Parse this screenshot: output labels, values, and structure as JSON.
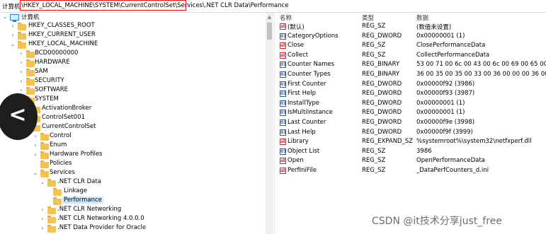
{
  "address": {
    "label": "计算机",
    "path": "\\HKEY_LOCAL_MACHINE\\SYSTEM\\CurrentControlSet\\Services\\.NET CLR Data\\Performance"
  },
  "tree": {
    "root": "计算机",
    "items": [
      {
        "label": "HKEY_CLASSES_ROOT"
      },
      {
        "label": "HKEY_CURRENT_USER"
      },
      {
        "label": "HKEY_LOCAL_MACHINE"
      },
      {
        "label": "BCD00000000"
      },
      {
        "label": "HARDWARE"
      },
      {
        "label": "SAM"
      },
      {
        "label": "SECURITY"
      },
      {
        "label": "SOFTWARE"
      },
      {
        "label": "SYSTEM"
      },
      {
        "label": "ActivationBroker"
      },
      {
        "label": "ControlSet001"
      },
      {
        "label": "CurrentControlSet"
      },
      {
        "label": "Control"
      },
      {
        "label": "Enum"
      },
      {
        "label": "Hardware Profiles"
      },
      {
        "label": "Policies"
      },
      {
        "label": "Services"
      },
      {
        "label": ".NET CLR Data"
      },
      {
        "label": "Linkage"
      },
      {
        "label": "Performance"
      },
      {
        "label": ".NET CLR Networking"
      },
      {
        "label": ".NET CLR Networking 4.0.0.0"
      },
      {
        "label": ".NET Data Provider for Oracle"
      }
    ]
  },
  "list": {
    "headers": {
      "name": "名称",
      "type": "类型",
      "data": "数据"
    },
    "rows": [
      {
        "icon": "ab",
        "name": "(默认)",
        "type": "REG_SZ",
        "data": "(数值未设置)"
      },
      {
        "icon": "bin",
        "name": "CategoryOptions",
        "type": "REG_DWORD",
        "data": "0x00000001 (1)"
      },
      {
        "icon": "ab",
        "name": "Close",
        "type": "REG_SZ",
        "data": "ClosePerformanceData"
      },
      {
        "icon": "ab",
        "name": "Collect",
        "type": "REG_SZ",
        "data": "CollectPerformanceData"
      },
      {
        "icon": "bin",
        "name": "Counter Names",
        "type": "REG_BINARY",
        "data": "53 00 71 00 6c 00 43 00 6c 00 69 00 65 00 6e..."
      },
      {
        "icon": "bin",
        "name": "Counter Types",
        "type": "REG_BINARY",
        "data": "36 00 35 00 35 00 33 00 36 00 00 00 36 00 35..."
      },
      {
        "icon": "bin",
        "name": "First Counter",
        "type": "REG_DWORD",
        "data": "0x00000f92 (3986)"
      },
      {
        "icon": "bin",
        "name": "First Help",
        "type": "REG_DWORD",
        "data": "0x00000f93 (3987)"
      },
      {
        "icon": "bin",
        "name": "InstallType",
        "type": "REG_DWORD",
        "data": "0x00000001 (1)"
      },
      {
        "icon": "bin",
        "name": "IsMultiInstance",
        "type": "REG_DWORD",
        "data": "0x00000001 (1)"
      },
      {
        "icon": "bin",
        "name": "Last Counter",
        "type": "REG_DWORD",
        "data": "0x00000f9e (3998)"
      },
      {
        "icon": "bin",
        "name": "Last Help",
        "type": "REG_DWORD",
        "data": "0x00000f9f (3999)"
      },
      {
        "icon": "ab",
        "name": "Library",
        "type": "REG_EXPAND_SZ",
        "data": "%systemroot%\\system32\\netfxperf.dll"
      },
      {
        "icon": "bin",
        "name": "Object List",
        "type": "REG_SZ",
        "data": "3986"
      },
      {
        "icon": "ab",
        "name": "Open",
        "type": "REG_SZ",
        "data": "OpenPerformanceData"
      },
      {
        "icon": "ab",
        "name": "PerfIniFile",
        "type": "REG_SZ",
        "data": "_DataPerfCounters_d.ini"
      }
    ]
  },
  "watermark": "CSDN @it技术分享just_free",
  "back_button": {
    "glyph": "<"
  },
  "colors": {
    "highlight_border": "#e11111",
    "folder": "#f3c34d",
    "selection": "#cce8ff"
  }
}
